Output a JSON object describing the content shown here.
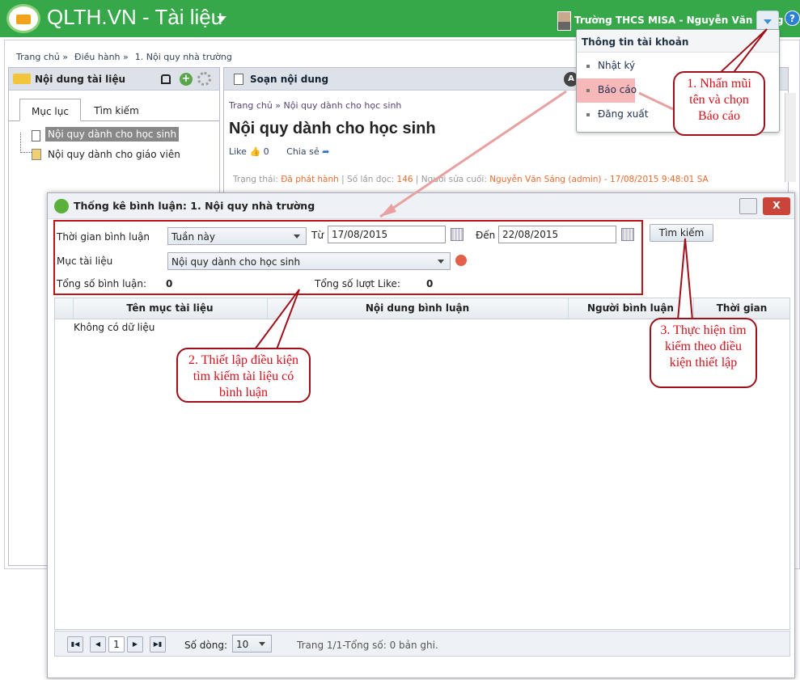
{
  "header": {
    "brand": "QLTH.VN",
    "module": " - Tài liệu",
    "user": "Trường THCS MISA - Nguyễn Văn Sáng",
    "help": "?"
  },
  "breadcrumb": [
    "Trang chủ »",
    "Điều hành »",
    "1. Nội quy nhà trường"
  ],
  "left_panel": {
    "title": "Nội dung tài liệu",
    "tabs": [
      "Mục lục",
      "Tìm kiếm"
    ],
    "tree": [
      "Nội quy dành cho học sinh",
      "Nội quy dành cho giáo viên"
    ]
  },
  "right_panel": {
    "title": "Soạn nội dung",
    "crumb": "Trang chủ  »  Nội quy dành cho học sinh",
    "doc_title": "Nội quy dành cho học sinh",
    "like": "Like",
    "like_count": "0",
    "share": "Chia sẻ",
    "status_label": "Trạng thái: ",
    "status": "Đã phát hành",
    "reads_label": " | Số lần đọc: ",
    "reads": "146",
    "editor_label": " | Người sửa cuối: ",
    "editor": "Nguyễn Văn Sáng (admin) - 17/08/2015 9:48:01 SA"
  },
  "account_menu": {
    "header": "Thông tin tài khoản",
    "items": [
      "Nhật ký",
      "Báo cáo",
      "Đăng xuất"
    ]
  },
  "dialog": {
    "title": "Thống kê bình luận: 1. Nội quy nhà trường",
    "close": "X",
    "time_label": "Thời gian bình luận",
    "time_value": "Tuần này",
    "from_label": "Từ",
    "from": "17/08/2015",
    "to_label": "Đến",
    "to": "22/08/2015",
    "search": "Tìm kiếm",
    "category_label": "Mục tài liệu",
    "category_value": "Nội quy dành cho học sinh",
    "total_comments_label": "Tổng số bình luận:",
    "total_comments": "0",
    "total_likes_label": "Tổng số lượt Like:",
    "total_likes": "0",
    "columns": [
      "Tên mục tài liệu",
      "Nội dung bình luận",
      "Người bình luận",
      "Thời gian"
    ],
    "empty": "Không có dữ liệu",
    "pager": {
      "page": "1",
      "rows_label": "Số dòng:",
      "rows": "10",
      "info": "Trang 1/1-Tổng số: 0 bản ghi."
    }
  },
  "callouts": [
    "1. Nhấn mũi tên và chọn Báo cáo",
    "2. Thiết lập điều kiện tìm kiếm tài liệu có bình luận",
    "3. Thực hiện tìm kiếm theo điều kiện thiết lập"
  ]
}
